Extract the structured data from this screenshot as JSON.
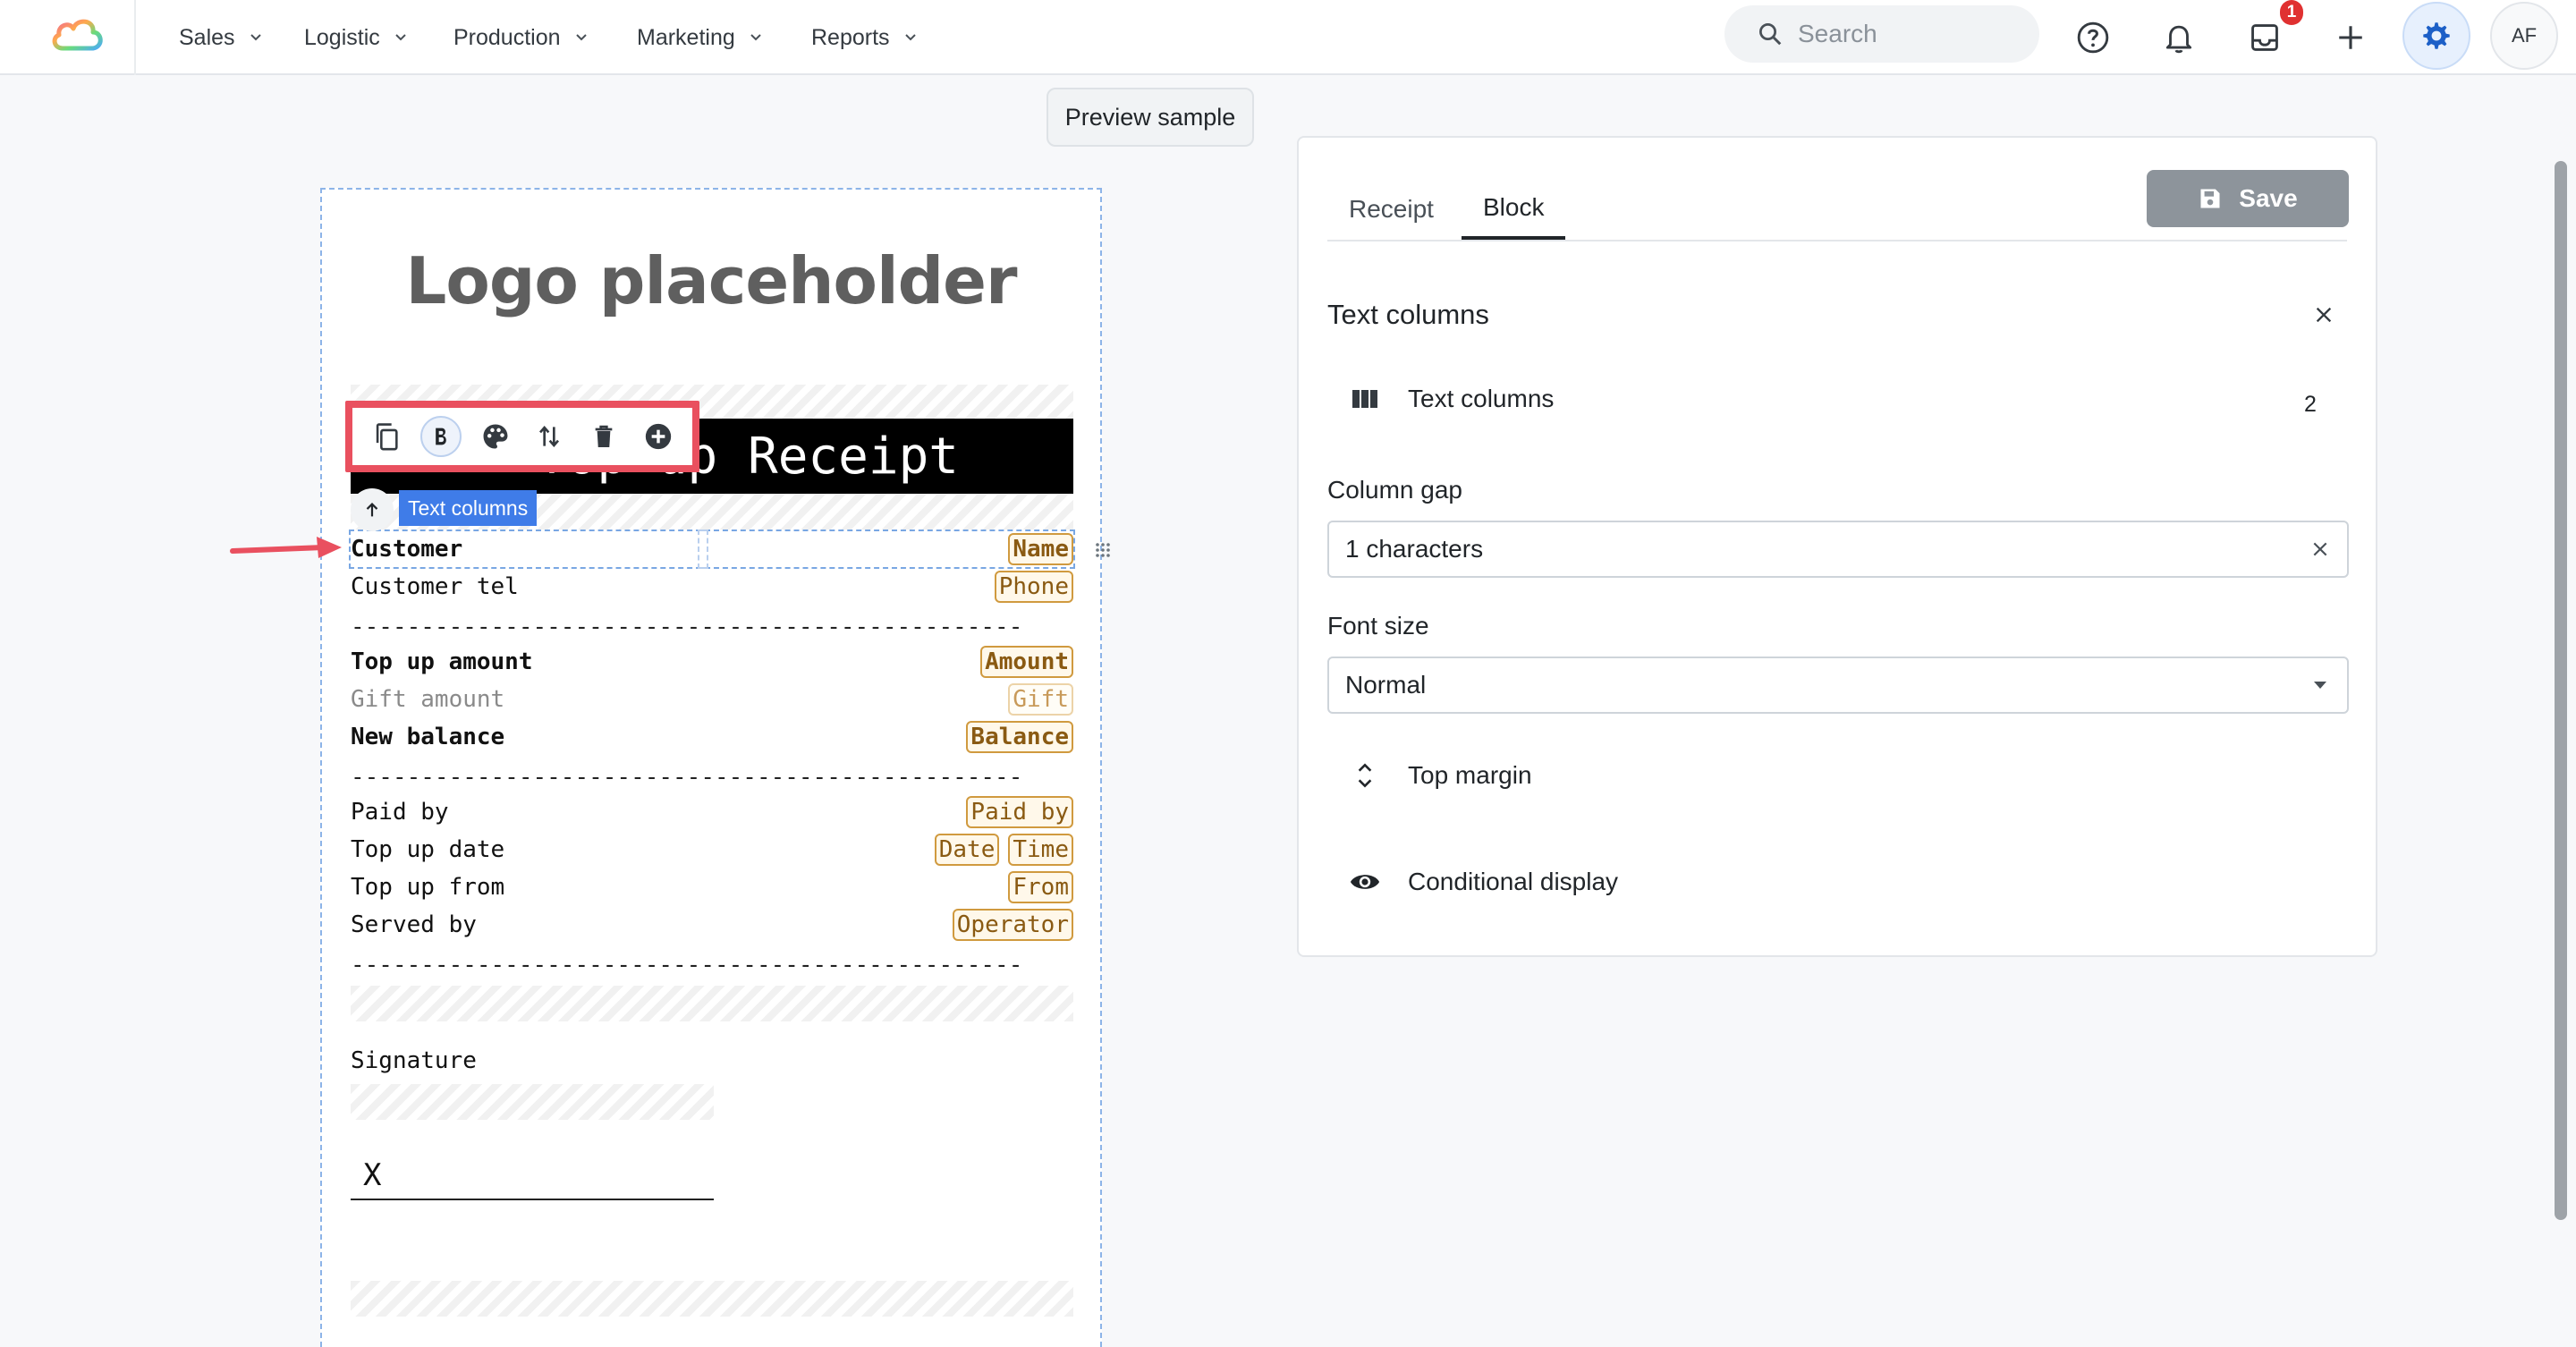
{
  "nav": {
    "items": [
      {
        "label": "Sales"
      },
      {
        "label": "Logistic"
      },
      {
        "label": "Production"
      },
      {
        "label": "Marketing"
      },
      {
        "label": "Reports"
      }
    ],
    "search_placeholder": "Search",
    "inbox_badge": "1",
    "avatar_initials": "AF"
  },
  "editor": {
    "preview_button": "Preview sample",
    "logo_placeholder": "Logo placeholder",
    "title": "Top up Receipt",
    "block_label": "Text columns",
    "lines": [
      {
        "label": "Customer",
        "tags": [
          "Name"
        ],
        "style": "bold"
      },
      {
        "label": "Customer tel",
        "tags": [
          "Phone"
        ],
        "style": "normal"
      },
      {
        "label": "Top up amount",
        "tags": [
          "Amount"
        ],
        "style": "bold"
      },
      {
        "label": "Gift amount",
        "tags": [
          "Gift"
        ],
        "style": "gray"
      },
      {
        "label": "New balance",
        "tags": [
          "Balance"
        ],
        "style": "bold"
      },
      {
        "label": "Paid by",
        "tags": [
          "Paid by"
        ],
        "style": "normal"
      },
      {
        "label": "Top up date",
        "tags": [
          "Date",
          "Time"
        ],
        "style": "normal"
      },
      {
        "label": "Top up from",
        "tags": [
          "From"
        ],
        "style": "normal"
      },
      {
        "label": "Served by",
        "tags": [
          "Operator"
        ],
        "style": "normal"
      }
    ],
    "separator": "------------------------------------------------",
    "signature_label": "Signature",
    "signature_x": "X"
  },
  "panel": {
    "tabs": [
      {
        "label": "Receipt"
      },
      {
        "label": "Block"
      }
    ],
    "active_tab": "Block",
    "save_label": "Save",
    "section_title": "Text columns",
    "columns_row": {
      "label": "Text columns",
      "value": "2"
    },
    "column_gap": {
      "label": "Column gap",
      "value": "1 characters"
    },
    "font_size": {
      "label": "Font size",
      "value": "Normal"
    },
    "top_margin_label": "Top margin",
    "conditional_label": "Conditional display"
  },
  "colors": {
    "accent": "#3f7ce8",
    "highlight": "#e9505f",
    "tag_border": "#d09a3f",
    "save_bg": "#8d949b"
  }
}
